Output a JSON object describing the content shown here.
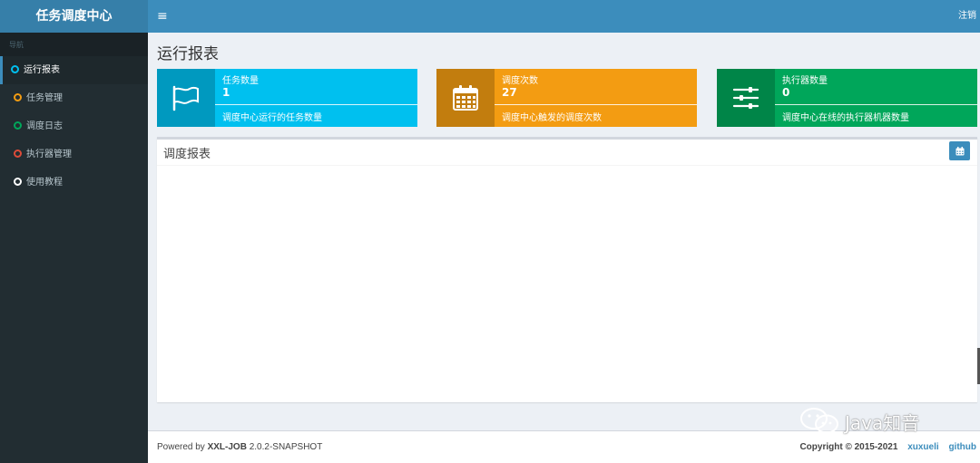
{
  "app": {
    "logo": "任务调度中心"
  },
  "header": {
    "menu_icon": "≡",
    "logout": "注销"
  },
  "sidebar": {
    "nav_header": "导航",
    "items": [
      {
        "label": "运行报表",
        "color": "#00c0ef",
        "active": true
      },
      {
        "label": "任务管理",
        "color": "#f39c12"
      },
      {
        "label": "调度日志",
        "color": "#00a65a"
      },
      {
        "label": "执行器管理",
        "color": "#dd4b39"
      },
      {
        "label": "使用教程",
        "color": "#ffffff"
      }
    ]
  },
  "page": {
    "title": "运行报表"
  },
  "info_boxes": [
    {
      "label": "任务数量",
      "number": "1",
      "desc": "调度中心运行的任务数量",
      "icon": "flag-icon",
      "bg": "#00c0ef",
      "icon_bg": "#0099bf"
    },
    {
      "label": "调度次数",
      "number": "27",
      "desc": "调度中心触发的调度次数",
      "icon": "calendar-icon",
      "bg": "#f39c12",
      "icon_bg": "#c27d0e"
    },
    {
      "label": "执行器数量",
      "number": "0",
      "desc": "调度中心在线的执行器机器数量",
      "icon": "sliders-icon",
      "bg": "#00a65a",
      "icon_bg": "#008548"
    }
  ],
  "report_box": {
    "title": "调度报表"
  },
  "footer": {
    "powered_prefix": "Powered by ",
    "powered_brand": "XXL-JOB",
    "version": " 2.0.2-SNAPSHOT",
    "copyright": "Copyright © 2015-2021",
    "link_author": "xuxueli",
    "link_github": "github"
  },
  "watermark": {
    "text": "Java知音"
  },
  "colors": {
    "navbar": "#3c8dbc",
    "logo_bg": "#367fa9",
    "sidebar": "#222d32"
  }
}
